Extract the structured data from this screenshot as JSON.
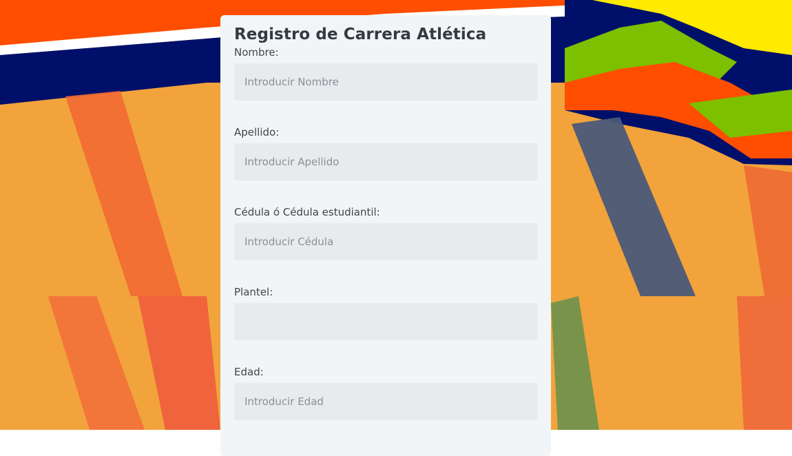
{
  "form": {
    "title": "Registro de Carrera Atlética",
    "fields": [
      {
        "label": "Nombre:",
        "placeholder": "Introducir Nombre",
        "value": ""
      },
      {
        "label": "Apellido:",
        "placeholder": "Introducir Apellido",
        "value": ""
      },
      {
        "label": "Cédula ó Cédula estudiantil:",
        "placeholder": "Introducir Cédula",
        "value": ""
      },
      {
        "label": "Plantel:",
        "placeholder": "",
        "value": ""
      },
      {
        "label": "Edad:",
        "placeholder": "Introducir Edad",
        "value": ""
      }
    ]
  },
  "colors": {
    "background_orange": "#f2a33c",
    "navy": "#00106a",
    "red_orange": "#ff4e00",
    "card": "#f1f5f7",
    "input": "#e7ebee"
  }
}
